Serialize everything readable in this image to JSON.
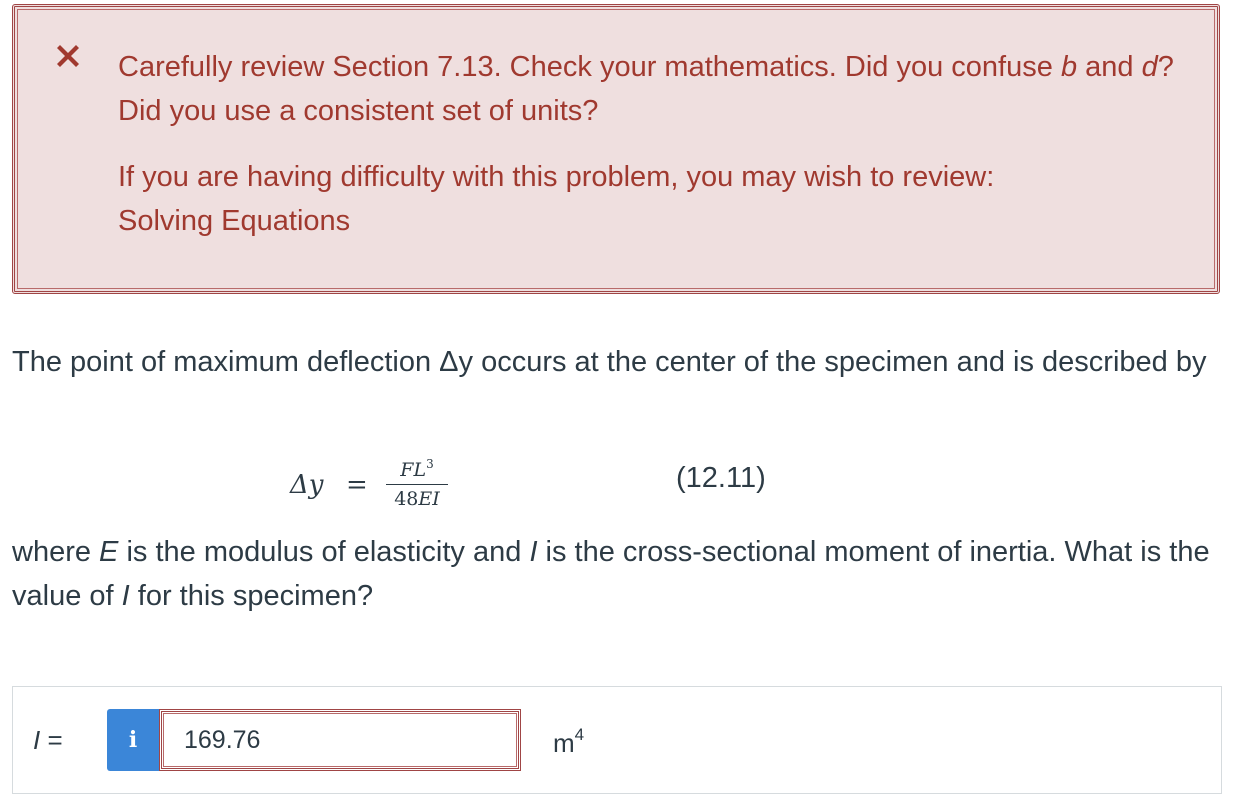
{
  "feedback": {
    "status": "incorrect",
    "icon": "close-icon",
    "color": "#a0392f",
    "message_part1": "Carefully review Section 7.13. Check your mathematics. Did you confuse ",
    "message_var_b": "b",
    "message_part2": " and ",
    "message_var_d": "d",
    "message_part3": "? Did you use a consistent set of units?",
    "review_prompt": "If you are having difficulty with this problem, you may wish to review:",
    "review_link": "Solving Equations"
  },
  "problem": {
    "intro": "The point of maximum deflection Δy occurs at the center of the specimen and is described by",
    "equation": {
      "lhs": "Δy",
      "equals": "=",
      "numerator": "FL",
      "numerator_exp": "3",
      "denominator_coef": "48",
      "denominator_vars": "EI",
      "number": "(12.11)"
    },
    "question_part1": "where ",
    "question_var_e": "E",
    "question_part2": " is the modulus of elasticity and ",
    "question_var_i": "I",
    "question_part3": " is the cross-sectional moment of inertia. What is the value of ",
    "question_var_i2": "I",
    "question_part4": " for this specimen?"
  },
  "answer": {
    "label_var": "I",
    "label_eq": " =",
    "info_icon": "info-icon",
    "value": "169.76",
    "unit_base": "m",
    "unit_exp": "4"
  }
}
